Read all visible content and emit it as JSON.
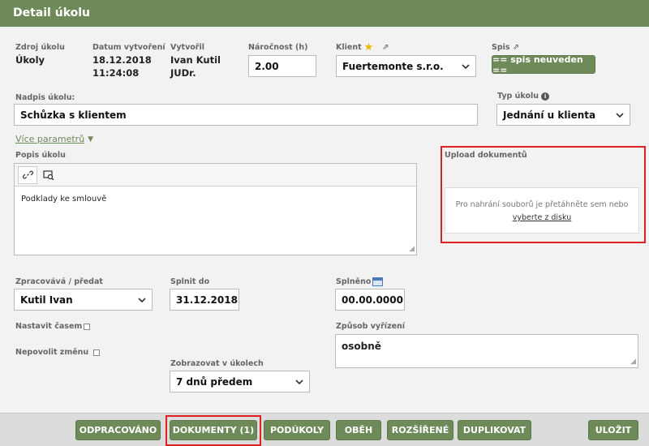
{
  "header": {
    "title": "Detail úkolu"
  },
  "fields": {
    "zdroj_label": "Zdroj úkolu",
    "zdroj_value": "Úkoly",
    "datum_label": "Datum vytvoření",
    "datum_value_1": "18.12.2018",
    "datum_value_2": "11:24:08",
    "vytvoril_label": "Vytvořil",
    "vytvoril_value_1": "Ivan Kutil",
    "vytvoril_value_2": "JUDr.",
    "narocnost_label": "Náročnost (h)",
    "narocnost_value": "2.00",
    "klient_label": "Klient",
    "klient_value": "Fuertemonte s.r.o.",
    "spis_label": "Spis",
    "spis_button": "== spis neuveden ==",
    "nadpis_label": "Nadpis úkolu:",
    "nadpis_value": "Schůzka s klientem",
    "typ_label": "Typ úkolu",
    "typ_value": "Jednání u klienta",
    "vice_parametru": "Více parametrů",
    "popis_label": "Popis úkolu",
    "popis_value": "Podklady ke smlouvě",
    "upload_label": "Upload dokumentů",
    "upload_hint": "Pro nahrání souborů je přetáhněte sem nebo",
    "upload_link": "vyberte z disku",
    "zpracovava_label": "Zpracovává / předat",
    "zpracovava_value": "Kutil Ivan",
    "splnit_label": "Splnit do",
    "splnit_value": "31.12.2018",
    "splneno_label": "Splněno",
    "splneno_value": "00.00.0000",
    "nastavit_label": "Nastavit časem",
    "nepovolit_label": "Nepovolit změnu",
    "zpusob_label": "Způsob vyřízení",
    "zpusob_value": "osobně",
    "zobrazovat_label": "Zobrazovat v úkolech",
    "zobrazovat_value": "7 dnů předem"
  },
  "footer": {
    "buttons": [
      "ODPRACOVÁNO",
      "DOKUMENTY (1)",
      "PODÚKOLY",
      "OBĚH",
      "ROZŠÍŘENÉ",
      "DUPLIKOVAT",
      "ULOŽIT"
    ]
  },
  "colors": {
    "accent": "#6e8a59",
    "highlight": "#e02020"
  }
}
